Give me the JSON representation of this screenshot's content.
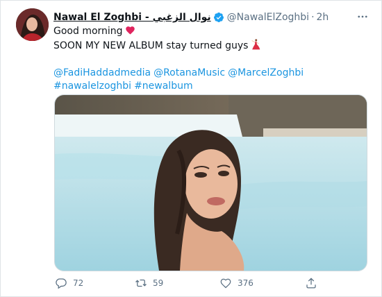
{
  "tweet": {
    "display_name": "Nawal El Zoghbi - نوال الزغبي",
    "handle": "@NawalElZoghbi",
    "separator": "·",
    "time": "2h",
    "lines": [
      "Good morning",
      "SOON MY NEW ALBUM stay turned guys"
    ],
    "mentions": [
      "@FadiHaddadmedia",
      "@RotanaMusic",
      "@MarcelZoghbi"
    ],
    "hashtags": [
      "#nawalelzoghbi",
      "#newalbum"
    ]
  },
  "actions": {
    "replies": "72",
    "retweets": "59",
    "likes": "376"
  },
  "icons": {
    "verified": "verified-badge-icon",
    "heart_emoji": "red-heart-emoji",
    "dancer_emoji": "dancer-emoji",
    "more": "more-dots-icon",
    "reply": "reply-icon",
    "retweet": "retweet-icon",
    "like": "like-icon",
    "share": "share-icon"
  },
  "colors": {
    "link": "#1b95e0",
    "verified": "#1da1f2",
    "muted": "#5b7083",
    "heart": "#e0245e"
  }
}
